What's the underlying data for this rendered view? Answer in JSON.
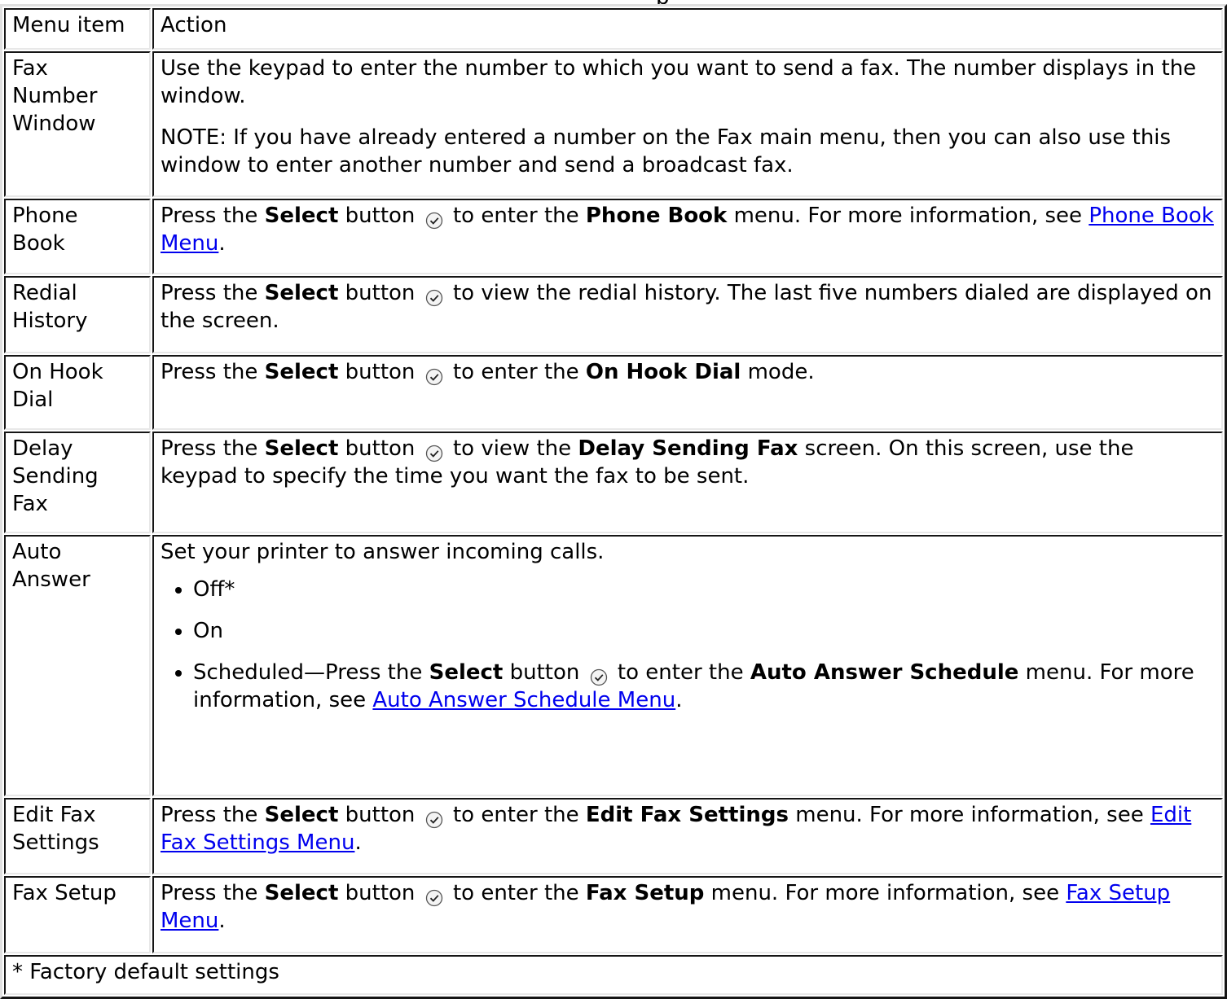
{
  "caption_fragment": "p",
  "header": {
    "menu_item": "Menu item",
    "action": "Action"
  },
  "rows": {
    "fax_number": {
      "label": [
        "Fax",
        "Number",
        "Window"
      ],
      "p1": "Use the keypad to enter the number to which you want to send a fax. The number displays in the window.",
      "p2": "NOTE: If you have already entered a number on the Fax main menu, then you can also use this window to enter another number and send a broadcast fax."
    },
    "phone_book": {
      "label": [
        "Phone",
        "Book"
      ],
      "t1": "Press the ",
      "b1": "Select",
      "t2": " button ",
      "t3": " to enter the ",
      "b2": "Phone Book",
      "t4": " menu. For more information, see ",
      "link": "Phone Book Menu",
      "t5": "."
    },
    "redial": {
      "label": [
        "Redial",
        "History"
      ],
      "t1": "Press the ",
      "b1": "Select",
      "t2": " button ",
      "t3": " to view the redial history. The last five numbers dialed are displayed on the screen."
    },
    "on_hook": {
      "label": [
        "On Hook",
        "Dial"
      ],
      "t1": "Press the ",
      "b1": "Select",
      "t2": " button ",
      "t3": " to enter the ",
      "b2": "On Hook Dial",
      "t4": " mode."
    },
    "delay": {
      "label": [
        "Delay",
        "Sending",
        "Fax"
      ],
      "t1": "Press the ",
      "b1": "Select",
      "t2": " button ",
      "t3": " to view the ",
      "b2": "Delay Sending Fax",
      "t4": " screen. On this screen, use the keypad to specify the time you want the fax to be sent."
    },
    "auto_answer": {
      "label": [
        "Auto",
        "Answer"
      ],
      "intro": "Set your printer to answer incoming calls.",
      "opt1": "Off*",
      "opt2": "On",
      "opt3_t1": "Scheduled—Press the ",
      "opt3_b1": "Select",
      "opt3_t2": " button ",
      "opt3_t3": " to enter the ",
      "opt3_b2": "Auto Answer Schedule",
      "opt3_t4": " menu. For more information, see ",
      "opt3_link": "Auto Answer Schedule Menu",
      "opt3_t5": "."
    },
    "edit_fax": {
      "label": [
        "Edit Fax",
        "Settings"
      ],
      "t1": "Press the ",
      "b1": "Select",
      "t2": " button ",
      "t3": " to enter the ",
      "b2": "Edit Fax Settings",
      "t4": " menu. For more information, see ",
      "link": "Edit Fax Settings Menu",
      "t5": "."
    },
    "fax_setup": {
      "label": [
        "Fax Setup"
      ],
      "t1": "Press the ",
      "b1": "Select",
      "t2": " button ",
      "t3": " to enter the ",
      "b2": "Fax Setup",
      "t4": " menu. For more information, see ",
      "link": "Fax Setup Menu",
      "t5": "."
    }
  },
  "footer": "* Factory default settings",
  "icons": {
    "select": "select-button-icon"
  }
}
